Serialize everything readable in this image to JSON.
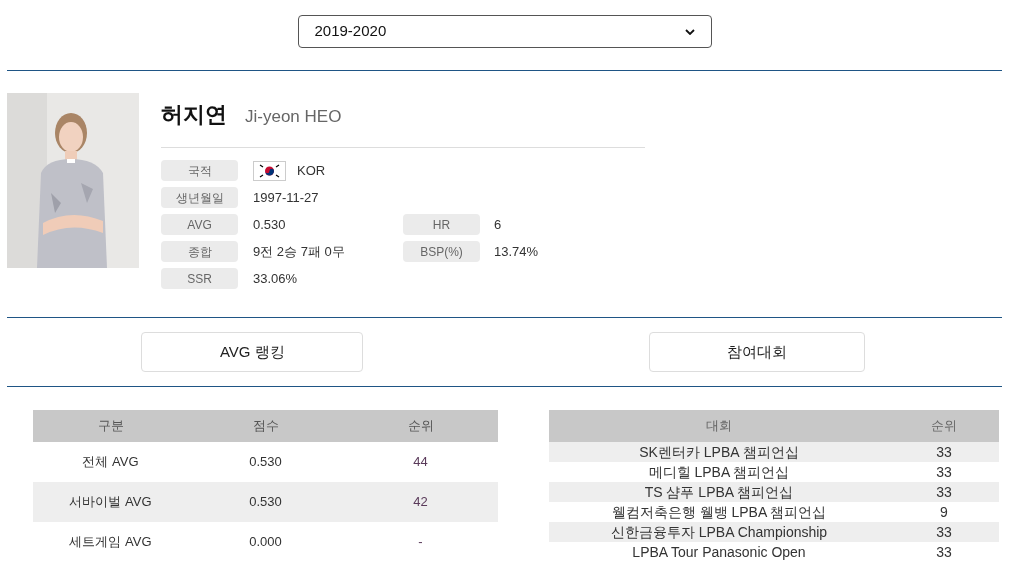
{
  "season_select": {
    "value": "2019-2020"
  },
  "player": {
    "name": "허지연",
    "name_en": "Ji-yeon HEO",
    "info": [
      {
        "label": "국적",
        "value": "KOR",
        "kind": "flag"
      },
      {
        "label": "생년월일",
        "value": "1997-11-27",
        "kind": "text"
      },
      {
        "label": "AVG",
        "value": "0.530",
        "kind": "text",
        "label2": "HR",
        "value2": "6"
      },
      {
        "label": "종합",
        "value": "9전 2승 7패 0무",
        "kind": "text",
        "label2": "BSP(%)",
        "value2": "13.74%"
      },
      {
        "label": "SSR",
        "value": "33.06%",
        "kind": "text"
      }
    ]
  },
  "tabs": [
    {
      "label": "AVG 랭킹"
    },
    {
      "label": "참여대회"
    }
  ],
  "avg_table": {
    "columns": [
      "구분",
      "점수",
      "순위"
    ],
    "rows": [
      [
        "전체 AVG",
        "0.530",
        "44"
      ],
      [
        "서바이벌 AVG",
        "0.530",
        "42"
      ],
      [
        "세트게임 AVG",
        "0.000",
        "-"
      ]
    ]
  },
  "tournament_table": {
    "columns": [
      "대회",
      "순위"
    ],
    "rows": [
      [
        "SK렌터카 LPBA 챔피언십",
        "33"
      ],
      [
        "메디힐 LPBA 챔피언십",
        "33"
      ],
      [
        "TS 샴푸 LPBA 챔피언십",
        "33"
      ],
      [
        "웰컴저축은행 웰뱅 LPBA 챔피언십",
        "9"
      ],
      [
        "신한금융투자 LPBA Championship",
        "33"
      ],
      [
        "LPBA Tour Panasonic Open",
        "33"
      ]
    ]
  }
}
